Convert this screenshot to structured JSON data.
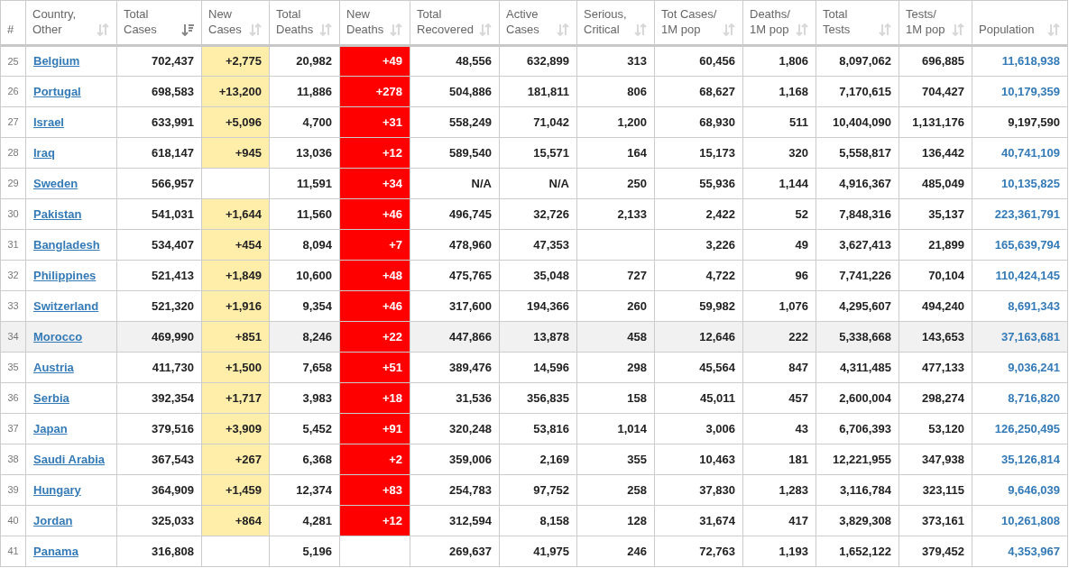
{
  "columns": [
    {
      "label": "#",
      "kind": "rank",
      "sortable": false,
      "sorted": false
    },
    {
      "label": "Country,\nOther",
      "kind": "country",
      "sortable": true,
      "sorted": false
    },
    {
      "label": "Total\nCases",
      "kind": "number",
      "sortable": true,
      "sorted": true
    },
    {
      "label": "New\nCases",
      "kind": "new_cases",
      "sortable": true,
      "sorted": false
    },
    {
      "label": "Total\nDeaths",
      "kind": "number",
      "sortable": true,
      "sorted": false
    },
    {
      "label": "New\nDeaths",
      "kind": "new_deaths",
      "sortable": true,
      "sorted": false
    },
    {
      "label": "Total\nRecovered",
      "kind": "number",
      "sortable": true,
      "sorted": false
    },
    {
      "label": "Active\nCases",
      "kind": "number",
      "sortable": true,
      "sorted": false
    },
    {
      "label": "Serious,\nCritical",
      "kind": "number",
      "sortable": true,
      "sorted": false
    },
    {
      "label": "Tot Cases/\n1M pop",
      "kind": "number",
      "sortable": true,
      "sorted": false
    },
    {
      "label": "Deaths/\n1M pop",
      "kind": "number",
      "sortable": true,
      "sorted": false
    },
    {
      "label": "Total\nTests",
      "kind": "number",
      "sortable": true,
      "sorted": false
    },
    {
      "label": "Tests/\n1M pop",
      "kind": "number",
      "sortable": true,
      "sorted": false
    },
    {
      "label": "Population",
      "kind": "population",
      "sortable": true,
      "sorted": false
    }
  ],
  "rows": [
    {
      "selected": false,
      "population_link": true,
      "cells": [
        "25",
        "Belgium",
        "702,437",
        "+2,775",
        "20,982",
        "+49",
        "48,556",
        "632,899",
        "313",
        "60,456",
        "1,806",
        "8,097,062",
        "696,885",
        "11,618,938"
      ]
    },
    {
      "selected": false,
      "population_link": true,
      "cells": [
        "26",
        "Portugal",
        "698,583",
        "+13,200",
        "11,886",
        "+278",
        "504,886",
        "181,811",
        "806",
        "68,627",
        "1,168",
        "7,170,615",
        "704,427",
        "10,179,359"
      ]
    },
    {
      "selected": false,
      "population_link": false,
      "cells": [
        "27",
        "Israel",
        "633,991",
        "+5,096",
        "4,700",
        "+31",
        "558,249",
        "71,042",
        "1,200",
        "68,930",
        "511",
        "10,404,090",
        "1,131,176",
        "9,197,590"
      ]
    },
    {
      "selected": false,
      "population_link": true,
      "cells": [
        "28",
        "Iraq",
        "618,147",
        "+945",
        "13,036",
        "+12",
        "589,540",
        "15,571",
        "164",
        "15,173",
        "320",
        "5,558,817",
        "136,442",
        "40,741,109"
      ]
    },
    {
      "selected": false,
      "population_link": true,
      "cells": [
        "29",
        "Sweden",
        "566,957",
        null,
        "11,591",
        "+34",
        "N/A",
        "N/A",
        "250",
        "55,936",
        "1,144",
        "4,916,367",
        "485,049",
        "10,135,825"
      ]
    },
    {
      "selected": false,
      "population_link": true,
      "cells": [
        "30",
        "Pakistan",
        "541,031",
        "+1,644",
        "11,560",
        "+46",
        "496,745",
        "32,726",
        "2,133",
        "2,422",
        "52",
        "7,848,316",
        "35,137",
        "223,361,791"
      ]
    },
    {
      "selected": false,
      "population_link": true,
      "cells": [
        "31",
        "Bangladesh",
        "534,407",
        "+454",
        "8,094",
        "+7",
        "478,960",
        "47,353",
        null,
        "3,226",
        "49",
        "3,627,413",
        "21,899",
        "165,639,794"
      ]
    },
    {
      "selected": false,
      "population_link": true,
      "cells": [
        "32",
        "Philippines",
        "521,413",
        "+1,849",
        "10,600",
        "+48",
        "475,765",
        "35,048",
        "727",
        "4,722",
        "96",
        "7,741,226",
        "70,104",
        "110,424,145"
      ]
    },
    {
      "selected": false,
      "population_link": true,
      "cells": [
        "33",
        "Switzerland",
        "521,320",
        "+1,916",
        "9,354",
        "+46",
        "317,600",
        "194,366",
        "260",
        "59,982",
        "1,076",
        "4,295,607",
        "494,240",
        "8,691,343"
      ]
    },
    {
      "selected": true,
      "population_link": true,
      "cells": [
        "34",
        "Morocco",
        "469,990",
        "+851",
        "8,246",
        "+22",
        "447,866",
        "13,878",
        "458",
        "12,646",
        "222",
        "5,338,668",
        "143,653",
        "37,163,681"
      ]
    },
    {
      "selected": false,
      "population_link": true,
      "cells": [
        "35",
        "Austria",
        "411,730",
        "+1,500",
        "7,658",
        "+51",
        "389,476",
        "14,596",
        "298",
        "45,564",
        "847",
        "4,311,485",
        "477,133",
        "9,036,241"
      ]
    },
    {
      "selected": false,
      "population_link": true,
      "cells": [
        "36",
        "Serbia",
        "392,354",
        "+1,717",
        "3,983",
        "+18",
        "31,536",
        "356,835",
        "158",
        "45,011",
        "457",
        "2,600,004",
        "298,274",
        "8,716,820"
      ]
    },
    {
      "selected": false,
      "population_link": true,
      "cells": [
        "37",
        "Japan",
        "379,516",
        "+3,909",
        "5,452",
        "+91",
        "320,248",
        "53,816",
        "1,014",
        "3,006",
        "43",
        "6,706,393",
        "53,120",
        "126,250,495"
      ]
    },
    {
      "selected": false,
      "population_link": true,
      "cells": [
        "38",
        "Saudi Arabia",
        "367,543",
        "+267",
        "6,368",
        "+2",
        "359,006",
        "2,169",
        "355",
        "10,463",
        "181",
        "12,221,955",
        "347,938",
        "35,126,814"
      ]
    },
    {
      "selected": false,
      "population_link": true,
      "cells": [
        "39",
        "Hungary",
        "364,909",
        "+1,459",
        "12,374",
        "+83",
        "254,783",
        "97,752",
        "258",
        "37,830",
        "1,283",
        "3,116,784",
        "323,115",
        "9,646,039"
      ]
    },
    {
      "selected": false,
      "population_link": true,
      "cells": [
        "40",
        "Jordan",
        "325,033",
        "+864",
        "4,281",
        "+12",
        "312,594",
        "8,158",
        "128",
        "31,674",
        "417",
        "3,829,308",
        "373,161",
        "10,261,808"
      ]
    },
    {
      "selected": false,
      "population_link": true,
      "cells": [
        "41",
        "Panama",
        "316,808",
        null,
        "5,196",
        null,
        "269,637",
        "41,975",
        "246",
        "72,763",
        "1,193",
        "1,652,122",
        "379,452",
        "4,353,967"
      ]
    }
  ]
}
